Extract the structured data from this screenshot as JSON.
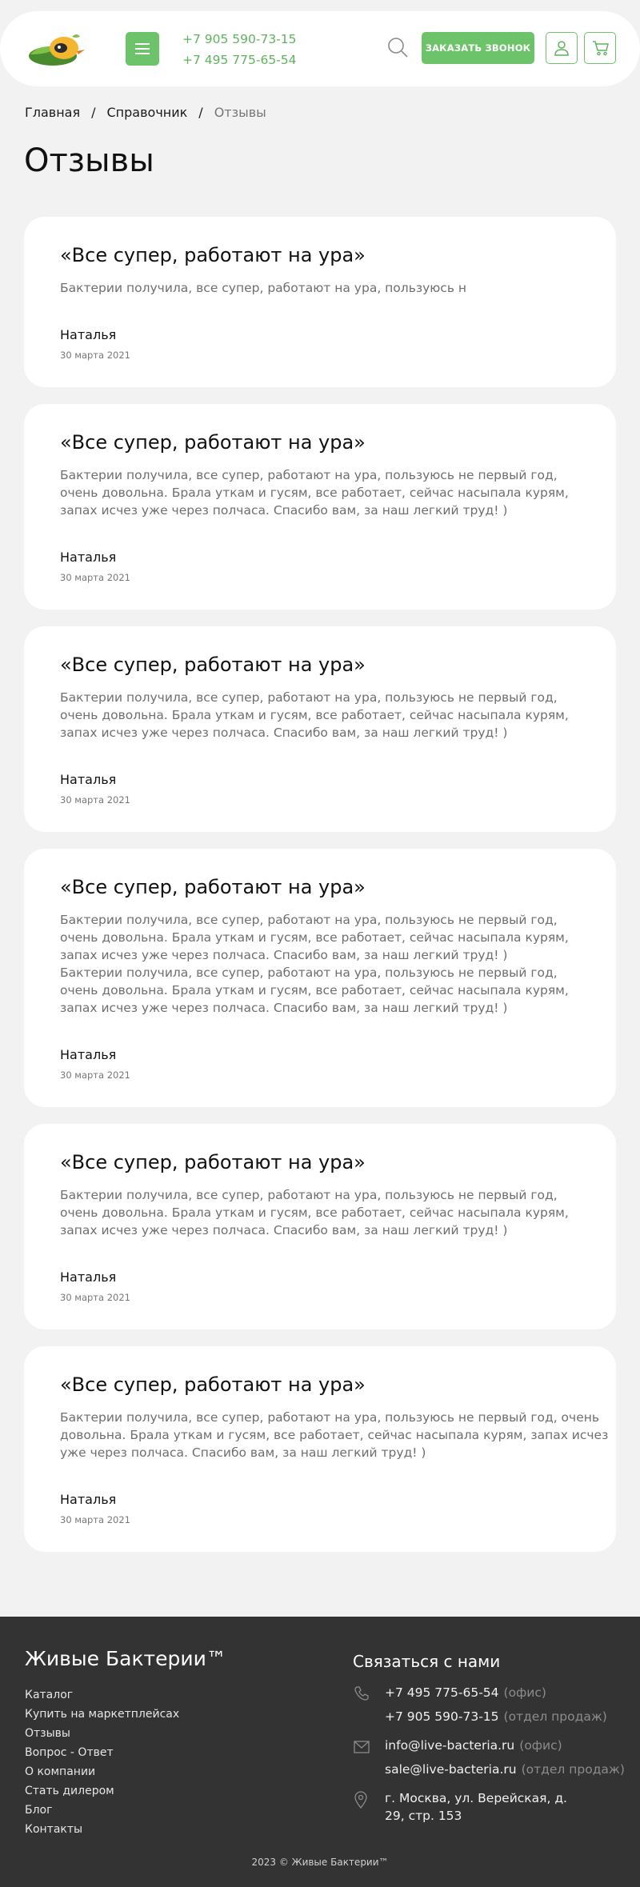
{
  "header": {
    "phones": [
      "+7 905 590-73-15",
      "+7 495 775-65-54"
    ],
    "call_button": "ЗАКАЗАТЬ ЗВОНОК",
    "icons": {
      "menu": "hamburger-icon",
      "search": "search-icon",
      "user": "user-icon",
      "cart": "cart-icon"
    },
    "accent_color": "#6cc36a"
  },
  "breadcrumb": {
    "items": [
      "Главная",
      "Справочник"
    ],
    "current": "Отзывы",
    "separator": "/"
  },
  "page_title": "Отзывы",
  "reviews": [
    {
      "title": "«Все супер, работают на ура»",
      "text": "Бактерии получила, все супер, работают на ура, пользуюсь н",
      "author": "Наталья",
      "date": "30 марта 2021"
    },
    {
      "title": "«Все супер, работают на ура»",
      "text": "Бактерии получила, все супер, работают на ура, пользуюсь не первый год, очень довольна. Брала уткам и гусям, все работает, сейчас насыпала курям, запах исчез уже через полчаса. Спасибо вам, за наш легкий труд! )",
      "author": "Наталья",
      "date": "30 марта 2021"
    },
    {
      "title": "«Все супер, работают на ура»",
      "text": "Бактерии получила, все супер, работают на ура, пользуюсь не первый год, очень довольна. Брала уткам и гусям, все работает, сейчас насыпала курям, запах исчез уже через полчаса. Спасибо вам, за наш легкий труд! )",
      "author": "Наталья",
      "date": "30 марта 2021"
    },
    {
      "title": "«Все супер, работают на ура»",
      "text": "Бактерии получила, все супер, работают на ура, пользуюсь не первый год, очень довольна. Брала уткам и гусям, все работает, сейчас насыпала курям, запах исчез уже через полчаса. Спасибо вам, за наш легкий труд! ) Бактерии получила, все супер, работают на ура, пользуюсь не первый год, очень довольна. Брала уткам и гусям, все работает, сейчас насыпала курям, запах исчез уже через полчаса. Спасибо вам, за наш легкий труд! )",
      "author": "Наталья",
      "date": "30 марта 2021"
    },
    {
      "title": "«Все супер, работают на ура»",
      "text": "Бактерии получила, все супер, работают на ура, пользуюсь не первый год, очень довольна. Брала уткам и гусям, все работает, сейчас насыпала курям, запах исчез уже через полчаса. Спасибо вам, за наш легкий труд! )",
      "author": "Наталья",
      "date": "30 марта 2021"
    },
    {
      "title": "«Все супер, работают на ура»",
      "text": "Бактерии получила, все супер, работают на ура, пользуюсь не первый год, очень довольна. Брала уткам и гусям, все работает, сейчас насыпала курям, запах исчез уже через полчаса. Спасибо вам, за наш легкий труд! )",
      "author": "Наталья",
      "date": "30 марта 2021"
    }
  ],
  "footer": {
    "brand": "Живые Бактерии™",
    "nav": [
      "Каталог",
      "Купить на маркетплейсах",
      "Отзывы",
      "Вопрос - Ответ",
      "О компании",
      "Стать дилером",
      "Блог",
      "Контакты"
    ],
    "contact_title": "Связаться с нами",
    "phones": [
      {
        "value": "+7 495 775-65-54",
        "note": "(офис)"
      },
      {
        "value": "+7 905 590-73-15",
        "note": "(отдел продаж)"
      }
    ],
    "emails": [
      {
        "value": "info@live-bacteria.ru",
        "note": "(офис)"
      },
      {
        "value": "sale@live-bacteria.ru",
        "note": "(отдел продаж)"
      }
    ],
    "address": [
      "г. Москва, ул. Верейская, д.",
      "29, стр. 153"
    ],
    "copyright": "2023 © Живые Бактерии™",
    "icons": {
      "phone": "phone-icon",
      "email": "mail-icon",
      "address": "location-pin-icon"
    }
  }
}
